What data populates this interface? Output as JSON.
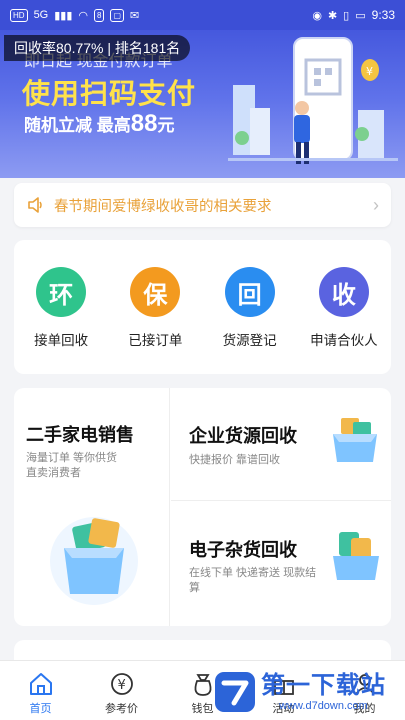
{
  "status_bar": {
    "left_chips": [
      "HD",
      "5G"
    ],
    "time": "9:33"
  },
  "overlay": {
    "rate_text": "回收率80.77% | 排名181名"
  },
  "banner": {
    "subtitle": "即日起 现金付款订单",
    "title": "使用扫码支付",
    "line3_prefix": "随机立减  最高",
    "line3_amount": "88",
    "line3_unit": "元"
  },
  "notice": {
    "text": "春节期间爱博绿收收哥的相关要求",
    "arrow": "›"
  },
  "quick_actions": [
    {
      "glyph": "环",
      "label": "接单回收",
      "color": "#2fc48c"
    },
    {
      "glyph": "保",
      "label": "已接订单",
      "color": "#f39a1f"
    },
    {
      "glyph": "回",
      "label": "货源登记",
      "color": "#2a8df0"
    },
    {
      "glyph": "收",
      "label": "申请合伙人",
      "color": "#5a63e0"
    }
  ],
  "services": {
    "left": {
      "title": "二手家电销售",
      "desc1": "海量订单  等你供货",
      "desc2": "直卖消费者"
    },
    "right_top": {
      "title": "企业货源回收",
      "desc": "快捷报价  靠谱回收"
    },
    "right_bottom": {
      "title": "电子杂货回收",
      "desc1": "在线下单  快递寄送  现款结",
      "desc2": "算"
    }
  },
  "bottom_nav": [
    {
      "label": "首页",
      "icon": "home-icon",
      "active": true
    },
    {
      "label": "参考价",
      "icon": "yen-icon",
      "active": false
    },
    {
      "label": "钱包",
      "icon": "wallet-icon",
      "active": false
    },
    {
      "label": "活动",
      "icon": "gift-icon",
      "active": false
    },
    {
      "label": "我的",
      "icon": "user-icon",
      "active": false
    }
  ],
  "watermark": {
    "text": "第一下载站",
    "url": "www.d7down.com"
  },
  "colors": {
    "primary": "#3a4dd8",
    "accent_yellow": "#ffe24a",
    "notice_orange": "#e9a23a",
    "nav_active": "#2a76f0"
  }
}
